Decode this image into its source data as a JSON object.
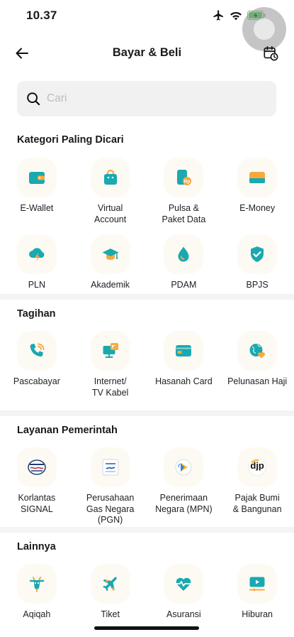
{
  "status_bar": {
    "time": "10.37"
  },
  "header": {
    "title": "Bayar & Beli"
  },
  "search": {
    "placeholder": "Cari"
  },
  "sections": {
    "kategori": {
      "title": "Kategori Paling Dicari",
      "items": [
        {
          "label": "E-Wallet",
          "icon": "wallet-icon"
        },
        {
          "label": "Virtual\nAccount",
          "icon": "shopping-bag-icon"
        },
        {
          "label": "Pulsa &\nPaket Data",
          "icon": "mobile-credit-icon"
        },
        {
          "label": "E-Money",
          "icon": "card-icon"
        },
        {
          "label": "PLN",
          "icon": "electricity-icon"
        },
        {
          "label": "Akademik",
          "icon": "graduation-cap-icon"
        },
        {
          "label": "PDAM",
          "icon": "water-drop-icon"
        },
        {
          "label": "BPJS",
          "icon": "shield-check-icon"
        }
      ]
    },
    "tagihan": {
      "title": "Tagihan",
      "items": [
        {
          "label": "Pascabayar",
          "icon": "phone-icon"
        },
        {
          "label": "Internet/\nTV Kabel",
          "icon": "internet-tv-icon"
        },
        {
          "label": "Hasanah Card",
          "icon": "credit-card-icon"
        },
        {
          "label": "Pelunasan Haji",
          "icon": "globe-heart-icon"
        }
      ]
    },
    "pemerintah": {
      "title": "Layanan Pemerintah",
      "items": [
        {
          "label": "Korlantas\nSIGNAL",
          "icon": "korlantas-logo-icon"
        },
        {
          "label": "Perusahaan\nGas Negara\n(PGN)",
          "icon": "pgn-logo-icon"
        },
        {
          "label": "Penerimaan\nNegara (MPN)",
          "icon": "mpn-logo-icon"
        },
        {
          "label": "Pajak Bumi\n& Bangunan",
          "icon": "djp-logo-icon",
          "logo_text": "djp"
        }
      ]
    },
    "lainnya": {
      "title": "Lainnya",
      "items": [
        {
          "label": "Aqiqah",
          "icon": "goat-icon"
        },
        {
          "label": "Tiket",
          "icon": "plane-icon"
        },
        {
          "label": "Asuransi",
          "icon": "heart-pulse-icon"
        },
        {
          "label": "Hiburan",
          "icon": "play-screen-icon"
        }
      ]
    }
  },
  "colors": {
    "teal": "#1aa9b0",
    "orange": "#f7a940",
    "tile_bg": "#fdfaf3"
  }
}
